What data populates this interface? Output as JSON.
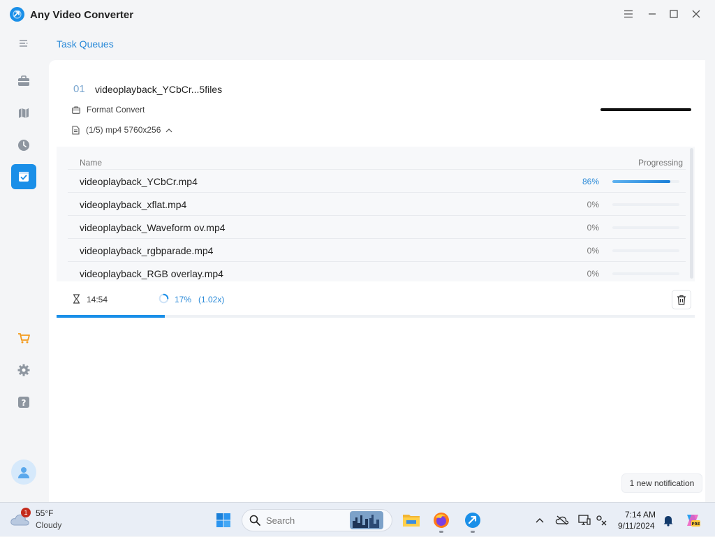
{
  "app": {
    "title": "Any Video Converter",
    "accent": "#1a8fe8"
  },
  "window_controls": [
    "menu-icon",
    "minimize-icon",
    "maximize-icon",
    "close-icon"
  ],
  "sidebar": {
    "items": [
      {
        "name": "collapse-icon",
        "active": false
      },
      {
        "name": "toolbox-icon",
        "active": false
      },
      {
        "name": "map-icon",
        "active": false
      },
      {
        "name": "history-icon",
        "active": false
      },
      {
        "name": "task-queue-icon",
        "active": true
      },
      {
        "name": "cart-icon",
        "active": false
      },
      {
        "name": "gear-icon",
        "active": false
      },
      {
        "name": "help-icon",
        "active": false
      },
      {
        "name": "avatar-icon",
        "active": false
      }
    ]
  },
  "header": {
    "tab_label": "Task Queues"
  },
  "task": {
    "number": "01",
    "title": "videoplayback_YCbCr...5files",
    "type_label": "Format Convert",
    "detail_label": "(1/5) mp4 5760x256",
    "columns": {
      "name": "Name",
      "progress": "Progressing"
    },
    "files": [
      {
        "name": "videoplayback_YCbCr.mp4",
        "percent_label": "86%",
        "progress": 0.86,
        "active": true
      },
      {
        "name": "videoplayback_xflat.mp4",
        "percent_label": "0%",
        "progress": 0,
        "active": false
      },
      {
        "name": "videoplayback_Waveform ov.mp4",
        "percent_label": "0%",
        "progress": 0,
        "active": false
      },
      {
        "name": "videoplayback_rgbparade.mp4",
        "percent_label": "0%",
        "progress": 0,
        "active": false
      },
      {
        "name": "videoplayback_RGB overlay.mp4",
        "percent_label": "0%",
        "progress": 0,
        "active": false
      }
    ],
    "time_remaining": "14:54",
    "overall_percent": "17%",
    "speed": "(1.02x)",
    "overall_progress": 0.17
  },
  "notification": {
    "text": "1 new notification"
  },
  "taskbar": {
    "weather": {
      "temp": "55°F",
      "condition": "Cloudy",
      "badge": "1"
    },
    "search_placeholder": "Search",
    "clock": {
      "time": "7:14 AM",
      "date": "9/11/2024"
    }
  }
}
